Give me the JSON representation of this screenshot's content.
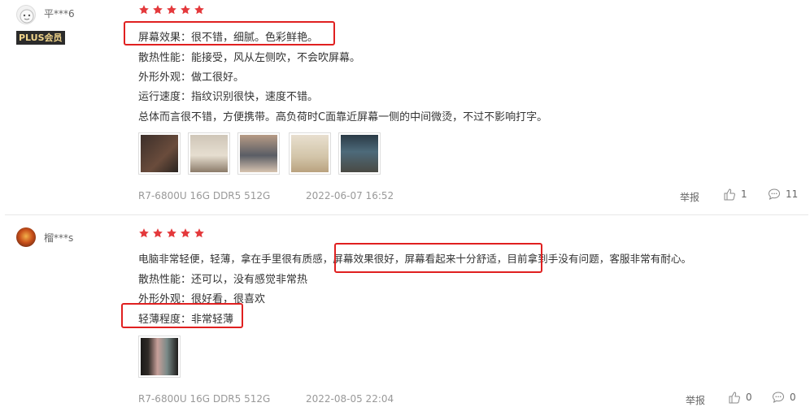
{
  "reviews": [
    {
      "user": "平***6",
      "badge": "PLUS会员",
      "lines": [
        "屏幕效果：很不错，细腻。色彩鲜艳。",
        "散热性能：能接受，风从左侧吹，不会吹屏幕。",
        "外形外观：做工很好。",
        "运行速度：指纹识别很快，速度不错。",
        "总体而言很不错，方便携带。高负荷时C面靠近屏幕一侧的中间微烫，不过不影响打字。"
      ],
      "config": "R7-6800U 16G DDR5 512G",
      "date": "2022-06-07 16:52",
      "report": "举报",
      "likes": "1",
      "comments": "11"
    },
    {
      "user": "榴***s",
      "lines": [
        "电脑非常轻便，轻薄，拿在手里很有质感，屏幕效果很好，屏幕看起来十分舒适，目前拿到手没有问题，客服非常有耐心。",
        "散热性能：还可以，没有感觉非常热",
        "外形外观：很好看，很喜欢",
        "轻薄程度：非常轻薄"
      ],
      "config": "R7-6800U 16G DDR5 512G",
      "date": "2022-08-05 22:04",
      "report": "举报",
      "likes": "0",
      "comments": "0"
    }
  ],
  "colors": {
    "star": "#e4393c",
    "highlight": "#e02020"
  }
}
